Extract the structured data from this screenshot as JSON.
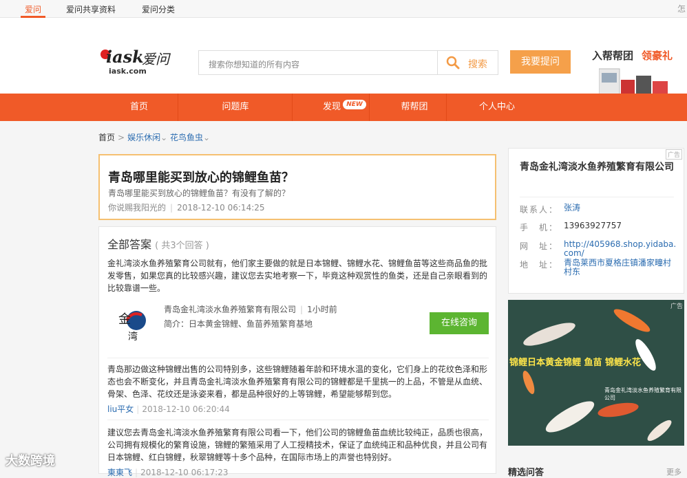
{
  "topbar": {
    "tabs": [
      "爱问",
      "爱问共享资料",
      "爱问分类"
    ],
    "corner": "怎"
  },
  "header": {
    "logo_word": "iask",
    "logo_cn": "爱问",
    "logo_sub": "iask.com",
    "search_placeholder": "搜索你想知道的所有内容",
    "search_button": "搜索",
    "ask_button": "我要提问",
    "promo_text1": "入帮帮团",
    "promo_text2": "领豪礼"
  },
  "nav": {
    "items": [
      "首页",
      "问题库",
      "发现",
      "帮帮团",
      "个人中心"
    ],
    "new_badge": "NEW"
  },
  "breadcrumb": {
    "home": "首页",
    "level1": "娱乐休闲",
    "level2": "花鸟鱼虫",
    "sep": ">"
  },
  "question": {
    "title": "青岛哪里能买到放心的锦鲤鱼苗？",
    "desc": "青岛哪里能买到放心的锦鲤鱼苗？有没有了解的？",
    "author": "你说赐我阳光的",
    "time": "2018-12-10 06:14:25"
  },
  "answers": {
    "heading": "全部答案",
    "count": "( 共3个回答 )",
    "a1_text": "金礼湾淡水鱼养殖繁育公司就有，他们家主要做的就是日本锦鲤、锦鲤水花、锦鲤鱼苗等这些商品鱼的批发零售，如果您真的比较感兴趣，建议您去实地考察一下，毕竟这种观赏性的鱼类，还是自己亲眼看到的比较靠谱一些。",
    "company_name": "青岛金礼湾淡水鱼养殖繁育有限公司",
    "company_time": "1小时前",
    "company_desc": "简介：日本黄金锦鲤、鱼苗养殖繁育基地",
    "consult_button": "在线咨询",
    "a2_text": "青岛那边做这种锦鲤出售的公司特别多，这些锦鲤随着年龄和环境水温的变化，它们身上的花纹色泽和形态也会不断变化，并且青岛金礼湾淡水鱼养殖繁育有限公司的锦鲤都是千里挑一的上品，不管是从血统、骨架、色泽、花纹还是泳姿来看，都是品种很好的上等锦鲤，希望能够帮到您。",
    "a2_user": "liu平女",
    "a2_time": "2018-12-10 06:20:44",
    "a3_text": "建议您去青岛金礼湾淡水鱼养殖繁育有限公司看一下，他们公司的锦鲤鱼苗血统比较纯正，品质也很高，公司拥有规模化的繁育设施，锦鲤的繁殖采用了人工授精技术，保证了血统纯正和品种优良，并且公司有日本锦鲤、红白锦鲤，秋翠锦鲤等十多个品种，在国际市场上的声誉也特别好。",
    "a3_user": "東東飞",
    "a3_time": "2018-12-10 06:17:23"
  },
  "sidebar": {
    "ad_label": "广告",
    "company": "青岛金礼湾淡水鱼养殖繁育有限公司",
    "contact_key": "联系人：",
    "contact_val": "张涛",
    "phone_key": "手　机：",
    "phone_val": "13963927757",
    "site_key": "网　址：",
    "site_val": "http://405968.shop.yidaba.com/",
    "addr_key": "地　址：",
    "addr_val": "青岛莱西市夏格庄镇潘家疃村村东",
    "img_banner": "锦鲤日本黄金锦鲤 鱼苗 锦鲤水花",
    "img_small": "青岛金礼湾淡水鱼养殖繁育有限公司",
    "img_ad": "广告",
    "section_title": "精选问答",
    "section_more": "更多"
  },
  "watermark": "大数跨境"
}
